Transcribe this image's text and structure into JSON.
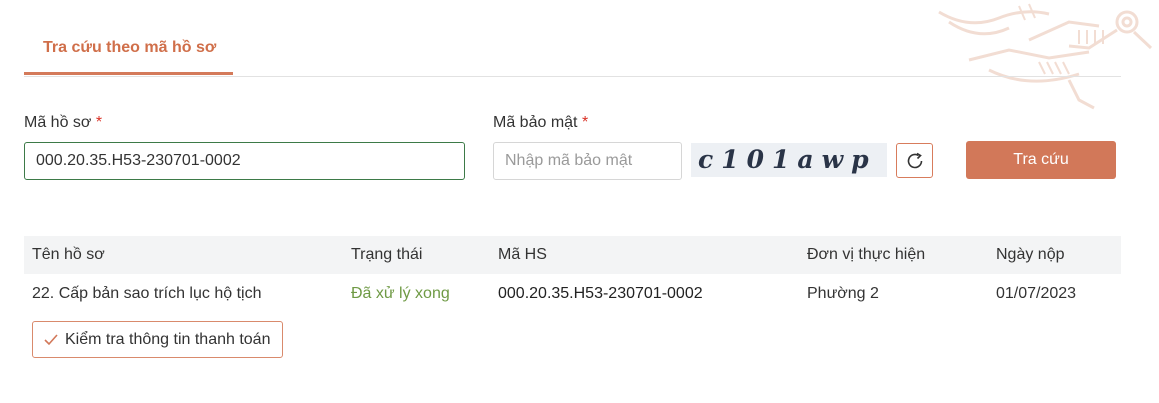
{
  "tabs": [
    {
      "label": "Tra cứu theo mã hồ sơ",
      "active": true
    }
  ],
  "form": {
    "code_label": "Mã hồ sơ",
    "code_value": "000.20.35.H53-230701-0002",
    "security_label": "Mã bảo mật",
    "required_mark": "*",
    "security_placeholder": "Nhập mã bảo mật",
    "captcha_text": "c101awp",
    "refresh_icon": "refresh-icon",
    "search_label": "Tra cứu"
  },
  "table": {
    "headers": [
      "Tên hồ sơ",
      "Trạng thái",
      "Mã HS",
      "Đơn vị thực hiện",
      "Ngày nộp"
    ],
    "rows": [
      {
        "name": "22. Cấp bản sao trích lục hộ tịch",
        "status": "Đã xử lý xong",
        "code": "000.20.35.H53-230701-0002",
        "unit": "Phường 2",
        "date": "01/07/2023"
      }
    ]
  },
  "actions": {
    "check_payment_label": "Kiểm tra thông tin thanh toán",
    "check_icon": "check-icon"
  },
  "colors": {
    "accent": "#d27859",
    "status_done": "#6f9a45",
    "code_border": "#3d7a48"
  }
}
